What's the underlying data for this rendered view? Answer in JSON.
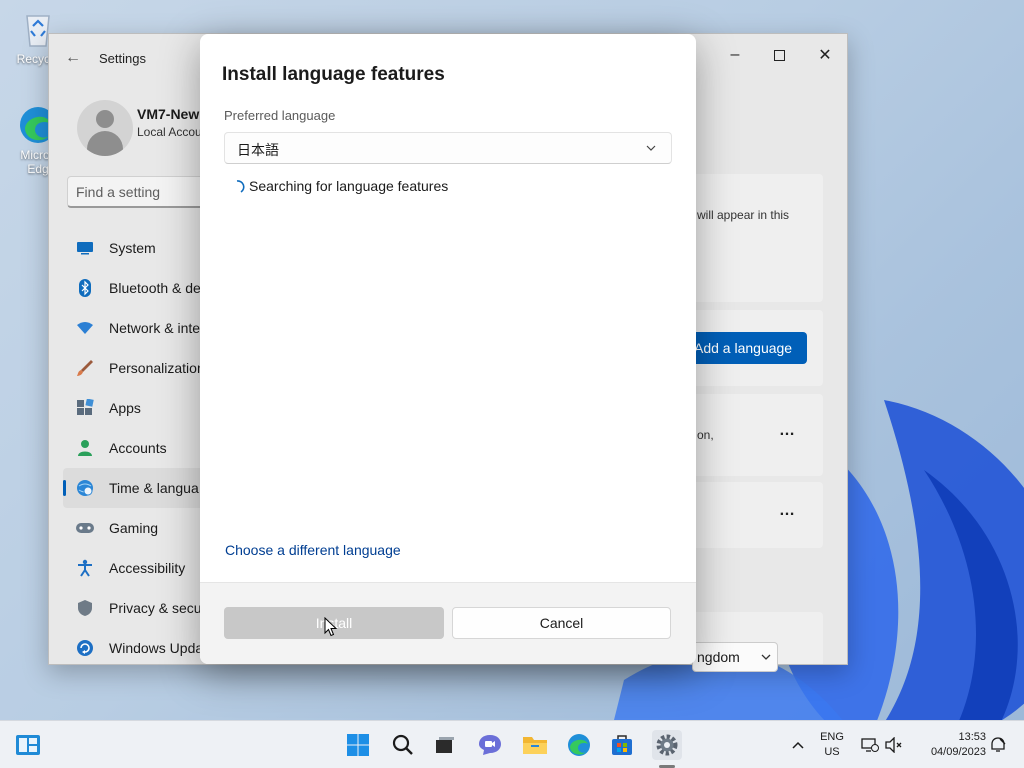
{
  "desktop": {
    "recycle_bin_label": "Recycle",
    "edge_label_line1": "Micros",
    "edge_label_line2": "Edg"
  },
  "settings_window": {
    "title": "Settings",
    "profile": {
      "name": "VM7-New",
      "subtitle": "Local Accou"
    },
    "search_placeholder": "Find a setting",
    "nav": [
      {
        "label": "System",
        "icon": "monitor-icon"
      },
      {
        "label": "Bluetooth & de",
        "icon": "bluetooth-icon"
      },
      {
        "label": "Network & inte",
        "icon": "wifi-icon"
      },
      {
        "label": "Personalization",
        "icon": "brush-icon"
      },
      {
        "label": "Apps",
        "icon": "apps-icon"
      },
      {
        "label": "Accounts",
        "icon": "person-icon"
      },
      {
        "label": "Time & langua",
        "icon": "globe-clock-icon",
        "active": true
      },
      {
        "label": "Gaming",
        "icon": "gamepad-icon"
      },
      {
        "label": "Accessibility",
        "icon": "accessibility-icon"
      },
      {
        "label": "Privacy & secur",
        "icon": "shield-icon"
      },
      {
        "label": "Windows Upda",
        "icon": "update-icon"
      }
    ],
    "content": {
      "card1_text": "will appear in this",
      "add_language_button": "Add a language",
      "card3_text": "on,",
      "more_glyph": "…",
      "region_value": "ngdom"
    }
  },
  "dialog": {
    "title": "Install language features",
    "preferred_language_label": "Preferred language",
    "preferred_language_value": "日本語",
    "status_text": "Searching for language features",
    "different_language_link": "Choose a different language",
    "install_button": "Install",
    "cancel_button": "Cancel"
  },
  "taskbar": {
    "lang_line1": "ENG",
    "lang_line2": "US",
    "time": "13:53",
    "date": "04/09/2023"
  },
  "colors": {
    "accent": "#005fb8",
    "link": "#003e92",
    "disabled_button": "#c8c8c8"
  }
}
